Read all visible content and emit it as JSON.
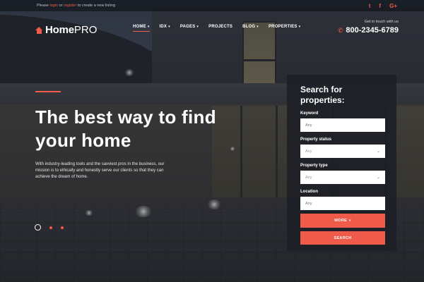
{
  "topbar": {
    "prefix": "Please",
    "login": "login",
    "or": "or",
    "register": "register",
    "suffix": "to create a new listing",
    "socials": [
      {
        "icon": "twitter-icon",
        "glyph": "t"
      },
      {
        "icon": "facebook-icon",
        "glyph": "f"
      },
      {
        "icon": "google-plus-icon",
        "glyph": "G+"
      }
    ]
  },
  "brand": {
    "bold": "Home",
    "light": "PRO",
    "accent": "#ef5a4b"
  },
  "nav": {
    "items": [
      {
        "label": "HOME",
        "caret": "▾",
        "active": true
      },
      {
        "label": "IDX",
        "caret": "▾"
      },
      {
        "label": "PAGES",
        "caret": "▾"
      },
      {
        "label": "PROJECTS",
        "caret": ""
      },
      {
        "label": "BLOG",
        "caret": "▾"
      },
      {
        "label": "PROPERTIES",
        "caret": "▾"
      }
    ]
  },
  "contact": {
    "label": "Get in touch with us",
    "phone": "800-2345-6789",
    "icon": "phone-icon"
  },
  "hero": {
    "title": "The best way to find your home",
    "text": "With industry-leading tools and the savviest pros in the business, our mission is to ethically and honestly serve our clients so that they can achieve the dream of home."
  },
  "slider": {
    "count": 3,
    "active_index": 0
  },
  "search": {
    "title": "Search for properties:",
    "keyword": {
      "label": "Keyword",
      "placeholder": "Any"
    },
    "status": {
      "label": "Property status",
      "value": "Any"
    },
    "type": {
      "label": "Property type",
      "value": "Any"
    },
    "location": {
      "label": "Location",
      "placeholder": "Any"
    },
    "more_label": "MORE",
    "search_label": "SEARCH"
  }
}
